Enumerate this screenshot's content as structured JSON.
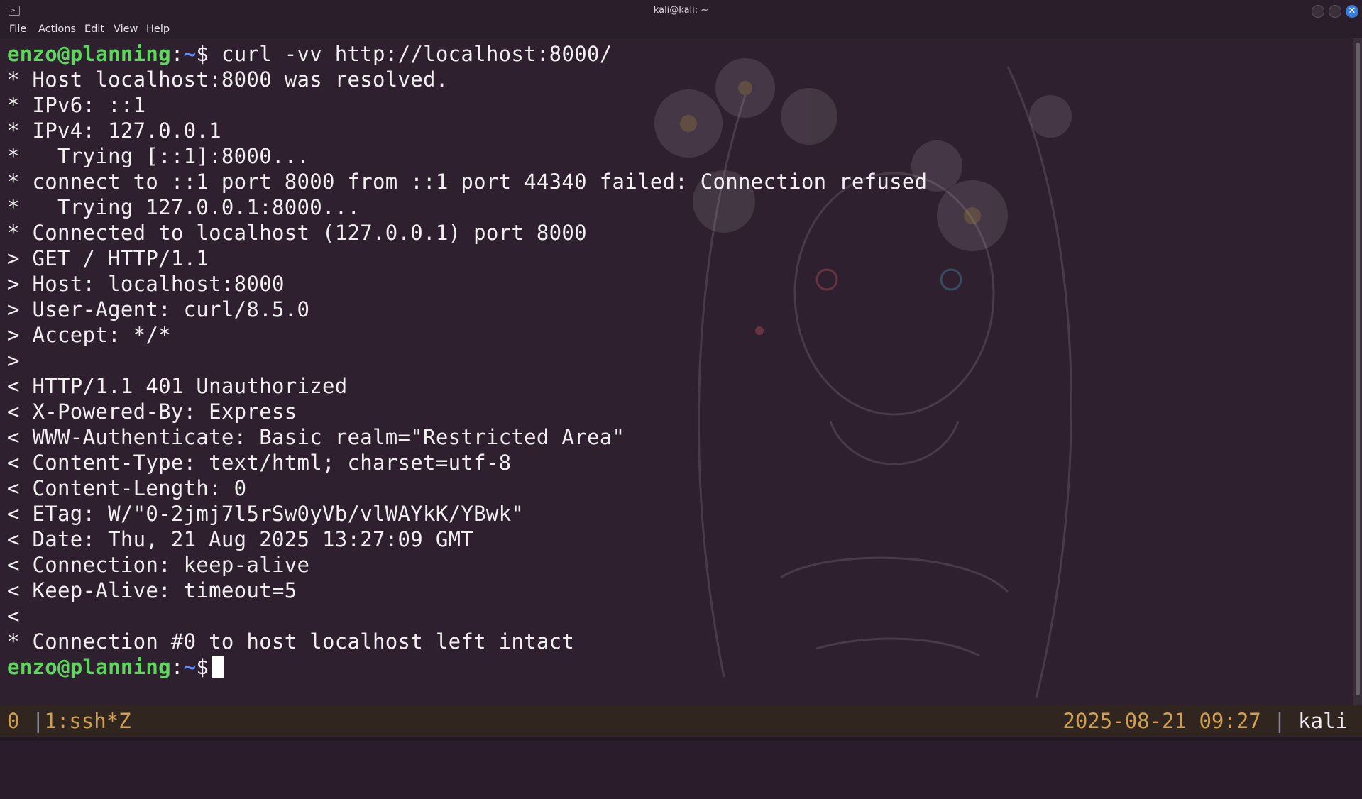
{
  "window": {
    "title": "kali@kali: ~",
    "app_icon": ">_",
    "close_glyph": "✕"
  },
  "menu": [
    "File",
    "Actions",
    "Edit",
    "View",
    "Help"
  ],
  "prompt": {
    "user_host": "enzo@planning",
    "colon": ":",
    "path": "~",
    "symbol": "$",
    "command": "curl -vv http://localhost:8000/"
  },
  "output": [
    "* Host localhost:8000 was resolved.",
    "* IPv6: ::1",
    "* IPv4: 127.0.0.1",
    "*   Trying [::1]:8000...",
    "* connect to ::1 port 8000 from ::1 port 44340 failed: Connection refused",
    "*   Trying 127.0.0.1:8000...",
    "* Connected to localhost (127.0.0.1) port 8000",
    "> GET / HTTP/1.1",
    "> Host: localhost:8000",
    "> User-Agent: curl/8.5.0",
    "> Accept: */*",
    ">",
    "< HTTP/1.1 401 Unauthorized",
    "< X-Powered-By: Express",
    "< WWW-Authenticate: Basic realm=\"Restricted Area\"",
    "< Content-Type: text/html; charset=utf-8",
    "< Content-Length: 0",
    "< ETag: W/\"0-2jmj7l5rSw0yVb/vlWAYkK/YBwk\"",
    "< Date: Thu, 21 Aug 2025 13:27:09 GMT",
    "< Connection: keep-alive",
    "< Keep-Alive: timeout=5",
    "<",
    "* Connection #0 to host localhost left intact"
  ],
  "status": {
    "session_index": "0",
    "separator": "|",
    "window_label": "1:ssh*Z",
    "datetime": "2025-08-21 09:27",
    "hostname": "kali"
  },
  "colors": {
    "prompt_user": "#5fd75f",
    "prompt_path": "#5f8fff",
    "status_accent": "#d0a050"
  }
}
